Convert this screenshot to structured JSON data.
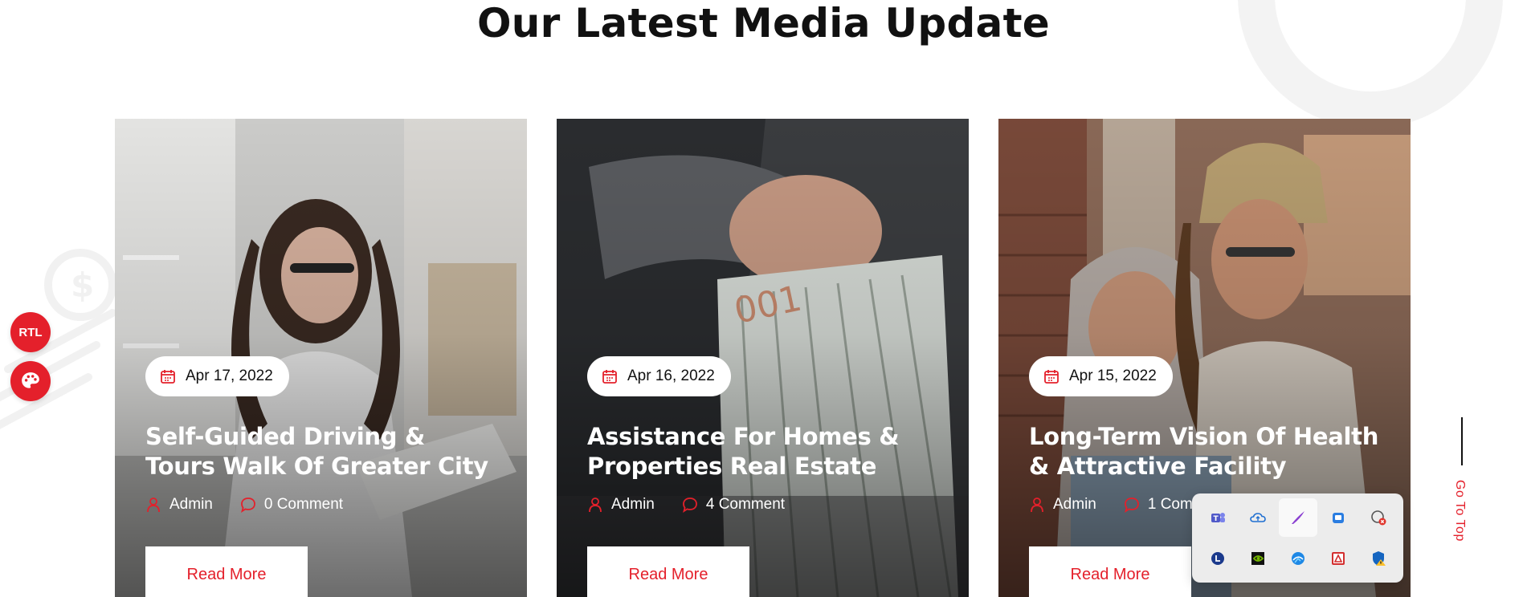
{
  "section": {
    "title": "Our Latest Media Update"
  },
  "side_buttons": {
    "rtl_label": "RTL"
  },
  "posts": [
    {
      "date": "Apr 17, 2022",
      "title": "Self-Guided Driving & Tours Walk Of Greater City",
      "author": "Admin",
      "comments": "0 Comment",
      "read_more": "Read More"
    },
    {
      "date": "Apr 16, 2022",
      "title": "Assistance For Homes & Properties Real Estate",
      "author": "Admin",
      "comments": "4 Comment",
      "read_more": "Read More"
    },
    {
      "date": "Apr 15, 2022",
      "title": "Long-Term Vision Of Health & Attractive Facility",
      "author": "Admin",
      "comments": "1 Com",
      "read_more": "Read More"
    }
  ],
  "go_top": {
    "label": "Go To Top"
  },
  "tray_icons": [
    "teams-icon",
    "onedrive-icon",
    "pen-icon",
    "store-icon",
    "network-error-icon",
    "clock-icon",
    "nvidia-icon",
    "browser-icon",
    "pdf-icon",
    "security-warning-icon"
  ],
  "colors": {
    "accent": "#e4202b",
    "title": "#111111"
  }
}
